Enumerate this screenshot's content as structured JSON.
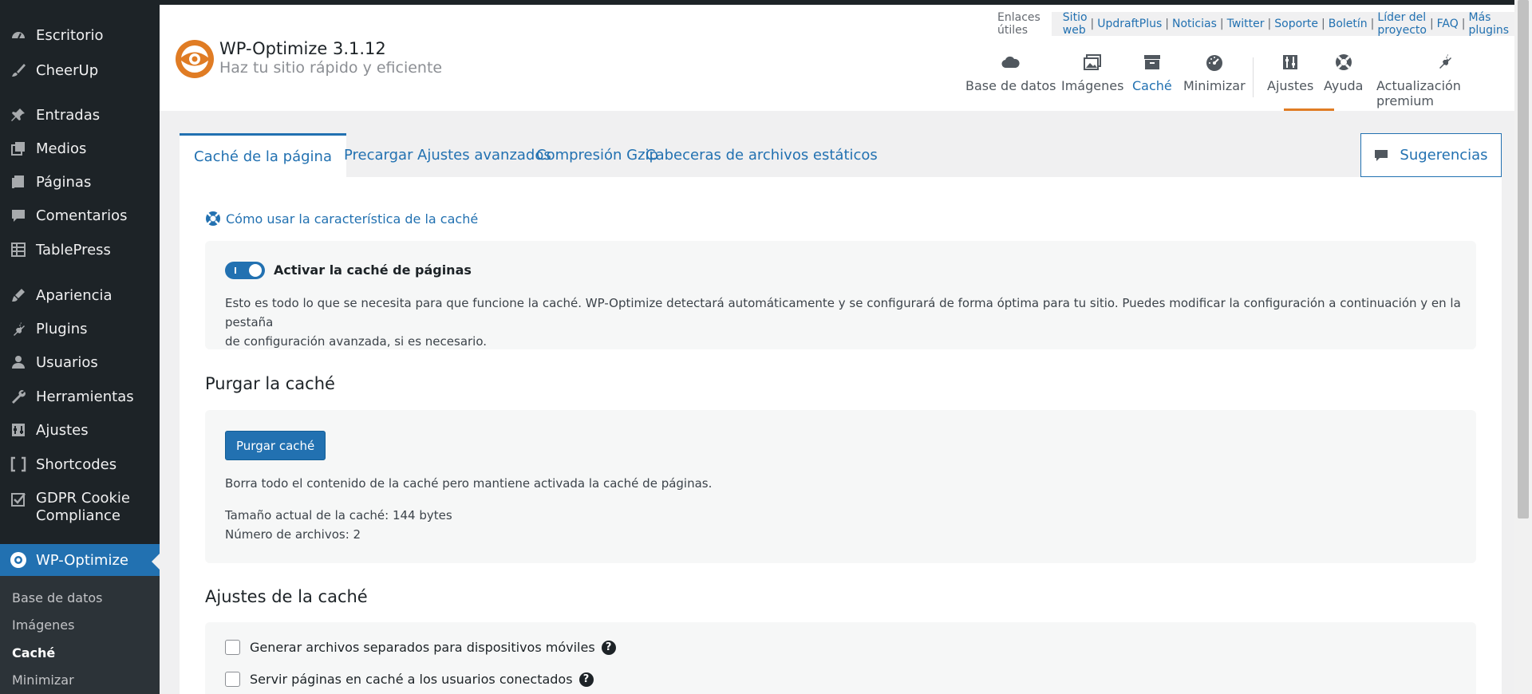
{
  "sidebar": {
    "items": [
      {
        "label": "Escritorio",
        "icon": "dashboard-icon"
      },
      {
        "label": "CheerUp",
        "icon": "brush-icon"
      },
      {
        "label": "Entradas",
        "icon": "pin-icon"
      },
      {
        "label": "Medios",
        "icon": "media-icon"
      },
      {
        "label": "Páginas",
        "icon": "pages-icon"
      },
      {
        "label": "Comentarios",
        "icon": "comment-icon"
      },
      {
        "label": "TablePress",
        "icon": "table-icon"
      },
      {
        "label": "Apariencia",
        "icon": "appearance-icon"
      },
      {
        "label": "Plugins",
        "icon": "plugin-icon"
      },
      {
        "label": "Usuarios",
        "icon": "user-icon"
      },
      {
        "label": "Herramientas",
        "icon": "wrench-icon"
      },
      {
        "label": "Ajustes",
        "icon": "settings-icon"
      },
      {
        "label": "Shortcodes",
        "icon": "brackets-icon"
      },
      {
        "label": "GDPR Cookie Compliance",
        "line1": "GDPR Cookie",
        "line2": "Compliance",
        "icon": "checkbox-icon"
      },
      {
        "label": "WP-Optimize",
        "icon": "wp-optimize-icon"
      }
    ],
    "submenu": [
      "Base de datos",
      "Imágenes",
      "Caché",
      "Minimizar"
    ]
  },
  "header": {
    "title": "WP-Optimize 3.1.12",
    "subtitle": "Haz tu sitio rápido y eficiente",
    "links_label": "Enlaces útiles",
    "links": [
      "Sitio web",
      "UpdraftPlus",
      "Noticias",
      "Twitter",
      "Soporte",
      "Boletín",
      "Líder del proyecto",
      "FAQ",
      "Más plugins"
    ],
    "nav": [
      "Base de datos",
      "Imágenes",
      "Caché",
      "Minimizar",
      "Ajustes",
      "Ayuda",
      "Actualización premium"
    ],
    "active_nav": "Caché"
  },
  "tabs": [
    "Caché de la página",
    "Precargar",
    "Ajustes avanzados",
    "Compresión Gzip",
    "Cabeceras de archivos estáticos"
  ],
  "suggestions_label": "Sugerencias",
  "main": {
    "help_link": "Cómo usar la característica de la caché",
    "enable": {
      "label": "Activar la caché de páginas",
      "enabled": true,
      "desc_line1": "Esto es todo lo que se necesita para que funcione la caché. WP-Optimize detectará automáticamente y se configurará de forma óptima para tu sitio. Puedes modificar la configuración a continuación y en la pestaña",
      "desc_line2": "de configuración avanzada, si es necesario."
    },
    "purge": {
      "heading": "Purgar la caché",
      "button": "Purgar caché",
      "desc": "Borra todo el contenido de la caché pero mantiene activada la caché de páginas.",
      "size": "Tamaño actual de la caché: 144 bytes",
      "files": "Número de archivos: 2"
    },
    "settings": {
      "heading": "Ajustes de la caché",
      "options": [
        "Generar archivos separados para dispositivos móviles",
        "Servir páginas en caché a los usuarios conectados"
      ]
    }
  },
  "colors": {
    "accent": "#2271b1",
    "sidebar": "#1d2327",
    "brand": "#e07c24"
  }
}
